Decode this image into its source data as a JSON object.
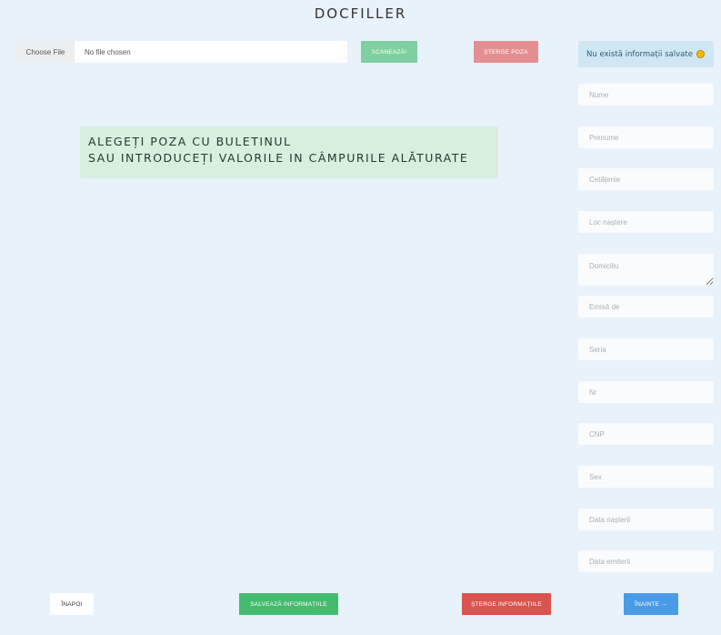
{
  "app": {
    "title": "DOCFILLER"
  },
  "upload": {
    "choose_label": "Choose File",
    "status": "No file chosen"
  },
  "toolbar": {
    "scan_label": "SCANEAZĂ!",
    "delete_photo_label": "ȘTERGE POZA"
  },
  "info": {
    "message": "Nu există informații salvate",
    "emoji_icon": "smiley-icon"
  },
  "instructions": {
    "line1": "ALEGEȚI POZA CU BULETINUL",
    "line2": "SAU INTRODUCEȚI VALORILE IN CÂMPURILE ALĂTURATE"
  },
  "fields": {
    "nume": "Nume",
    "prenume": "Prenume",
    "cetatenie": "Cetățenie",
    "loc_nastere": "Loc naștere",
    "domiciliu": "Domiciliu",
    "emisa_de": "Emisă de",
    "seria": "Seria",
    "nr": "Nr",
    "cnp": "CNP",
    "sex": "Sex",
    "data_nasterii": "Data nașterii",
    "data_emiterii": "Data emiterii"
  },
  "footer": {
    "back_label": "ÎNAPOI",
    "save_label": "SALVEAZĂ INFORMAȚIILE",
    "delete_label": "ȘTERGE INFORMAȚIILE",
    "next_label": "ÎNAINTE →"
  },
  "colors": {
    "background": "#e8f2fb",
    "scan": "#7fcfa0",
    "delete_photo": "#e58e91",
    "info": "#cfe7f3",
    "save": "#45bb6e",
    "delete": "#d9534f",
    "next": "#4a9be5"
  }
}
